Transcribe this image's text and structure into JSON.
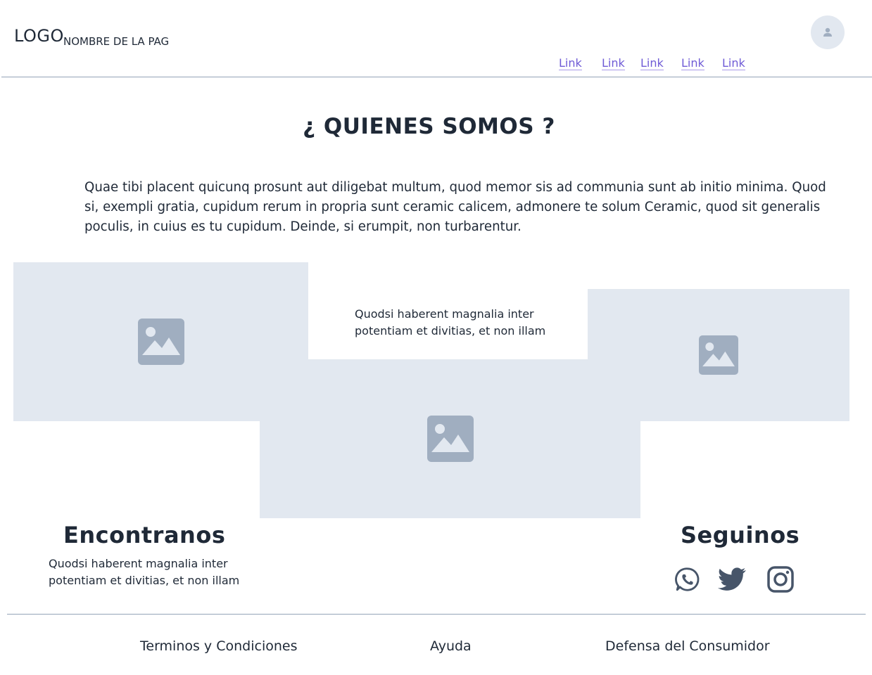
{
  "header": {
    "logo": "LOGO",
    "page_name": "NOMBRE DE LA PAG",
    "nav_links": [
      "Link",
      "Link",
      "Link",
      "Link",
      "Link"
    ],
    "avatar_icon": "user-icon"
  },
  "main": {
    "title": "¿ QUIENES SOMOS ?",
    "paragraph": "Quae tibi placent quicunq prosunt aut diligebat multum, quod memor sis ad communia sunt ab initio minima. Quod si, exempli gratia, cupidum rerum in propria sunt ceramic calicem, admonere te solum Ceramic, quod sit generalis poculis, in cuius es tu cupidum. Deinde, si erumpit, non turbarentur.",
    "image_icon": "image-placeholder-icon",
    "image_caption": "Quodsi haberent magnalia inter potentiam et divitias, et non illam"
  },
  "find_us": {
    "heading": "Encontranos",
    "text": "Quodsi haberent magnalia inter potentiam et divitias, et non illam"
  },
  "follow_us": {
    "heading": "Seguinos",
    "icons": [
      "whatsapp-icon",
      "twitter-icon",
      "instagram-icon"
    ]
  },
  "footer": {
    "links": [
      "Terminos y Condiciones",
      "Ayuda",
      "Defensa del Consumidor"
    ]
  },
  "colors": {
    "placeholder_bg": "#e2e8f0",
    "placeholder_icon": "#a0aec0",
    "link": "#6f5bd6",
    "text": "#1f2937",
    "divider": "#94a3b8",
    "social_icon": "#475569"
  }
}
